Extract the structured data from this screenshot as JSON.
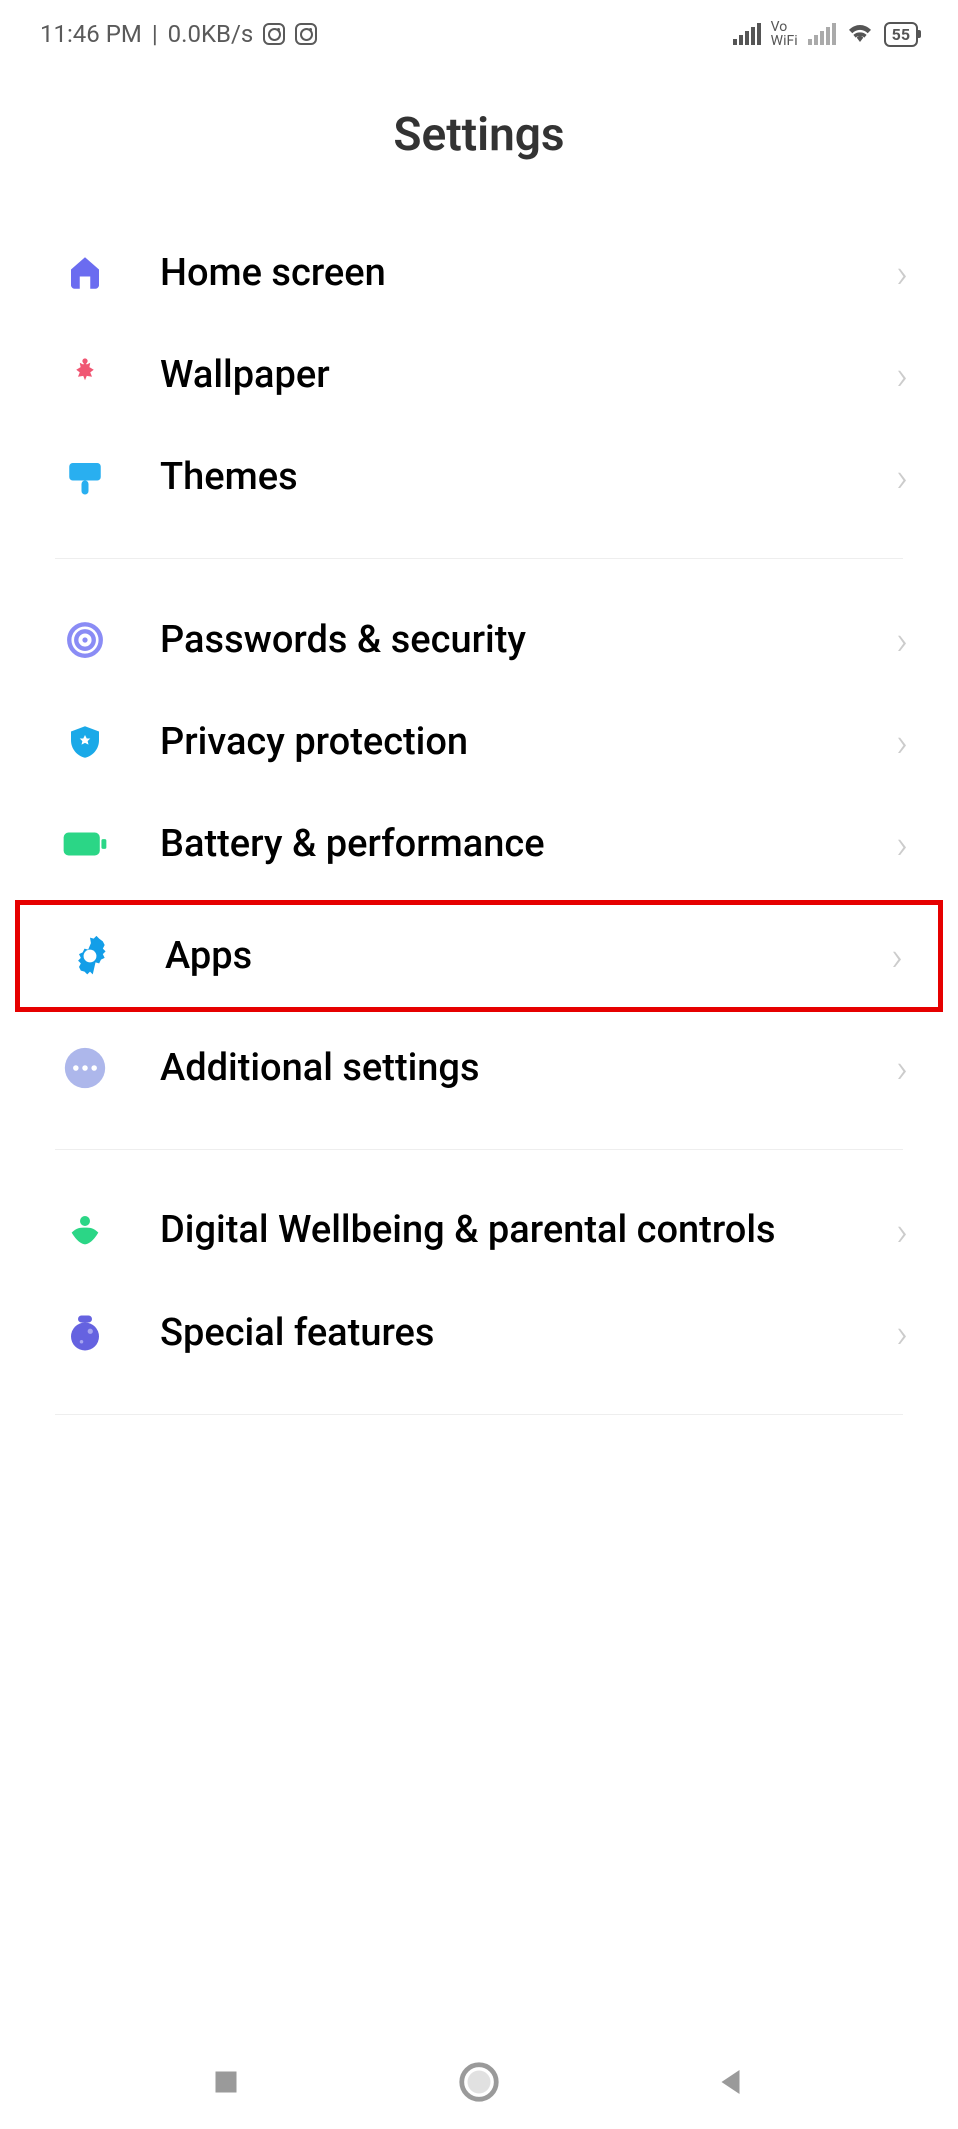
{
  "statusBar": {
    "time": "11:46 PM",
    "dataRate": "0.0KB/s",
    "battery": "55"
  },
  "header": {
    "title": "Settings"
  },
  "group1": [
    {
      "label": "Home screen"
    },
    {
      "label": "Wallpaper"
    },
    {
      "label": "Themes"
    }
  ],
  "group2": [
    {
      "label": "Passwords & security"
    },
    {
      "label": "Privacy protection"
    },
    {
      "label": "Battery & performance"
    },
    {
      "label": "Apps"
    },
    {
      "label": "Additional settings"
    }
  ],
  "group3": [
    {
      "label": "Digital Wellbeing & parental controls"
    },
    {
      "label": "Special features"
    }
  ]
}
